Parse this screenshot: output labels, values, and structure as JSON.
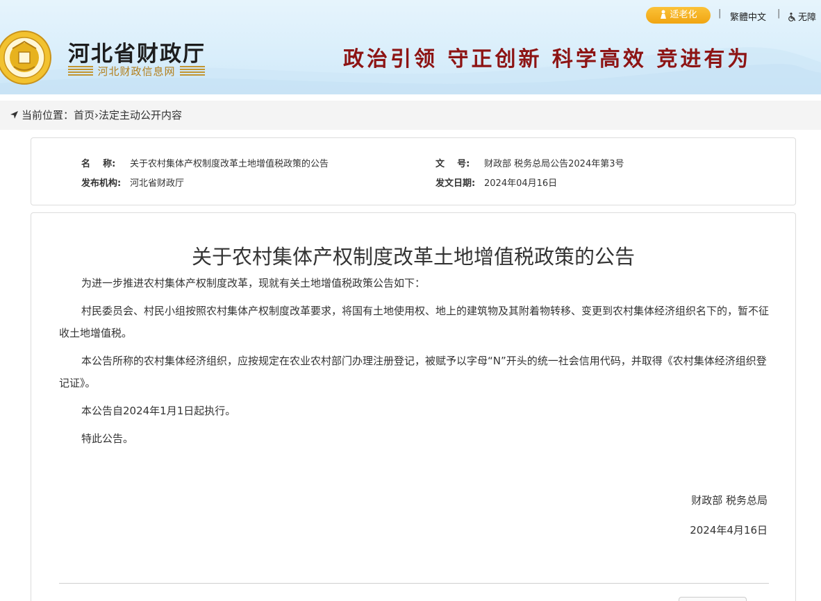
{
  "header": {
    "site_title": "河北省财政厅",
    "site_subtitle": "河北财政信息网",
    "slogan": "政治引领 守正创新 科学高效 竞进有为",
    "elder_mode_label": "适老化",
    "traditional_chinese_label": "繁體中文",
    "accessibility_label": "无障",
    "separator": "|"
  },
  "breadcrumb": {
    "prefix": "当前位置：",
    "home": "首页",
    "arrow": "›",
    "current": "法定主动公开内容"
  },
  "meta": {
    "name_label": "名    称:",
    "name_value": "关于农村集体产权制度改革土地增值税政策的公告",
    "doc_no_label": "文    号:",
    "doc_no_value": "财政部 税务总局公告2024年第3号",
    "publisher_label": "发布机构:",
    "publisher_value": "河北省财政厅",
    "date_label": "发文日期:",
    "date_value": "2024年04月16日"
  },
  "article": {
    "title": "关于农村集体产权制度改革土地增值税政策的公告",
    "paragraphs": [
      "为进一步推进农村集体产权制度改革，现就有关土地增值税政策公告如下：",
      "村民委员会、村民小组按照农村集体产权制度改革要求，将国有土地使用权、地上的建筑物及其附着物转移、变更到农村集体经济组织名下的，暂不征收土地增值税。",
      "本公告所称的农村集体经济组织，应按规定在农业农村部门办理注册登记，被赋予以字母“N”开头的统一社会信用代码，并取得《农村集体经济组织登记证》。",
      "本公告自2024年1月1日起执行。",
      "特此公告。"
    ],
    "signature": "财政部 税务总局",
    "sign_date": "2024年4月16日"
  },
  "colors": {
    "slogan": "#8d1414",
    "elder_button": "#f0a512",
    "header_bg": "#d9eefb",
    "breadcrumb_bg": "#f4f4f4"
  }
}
